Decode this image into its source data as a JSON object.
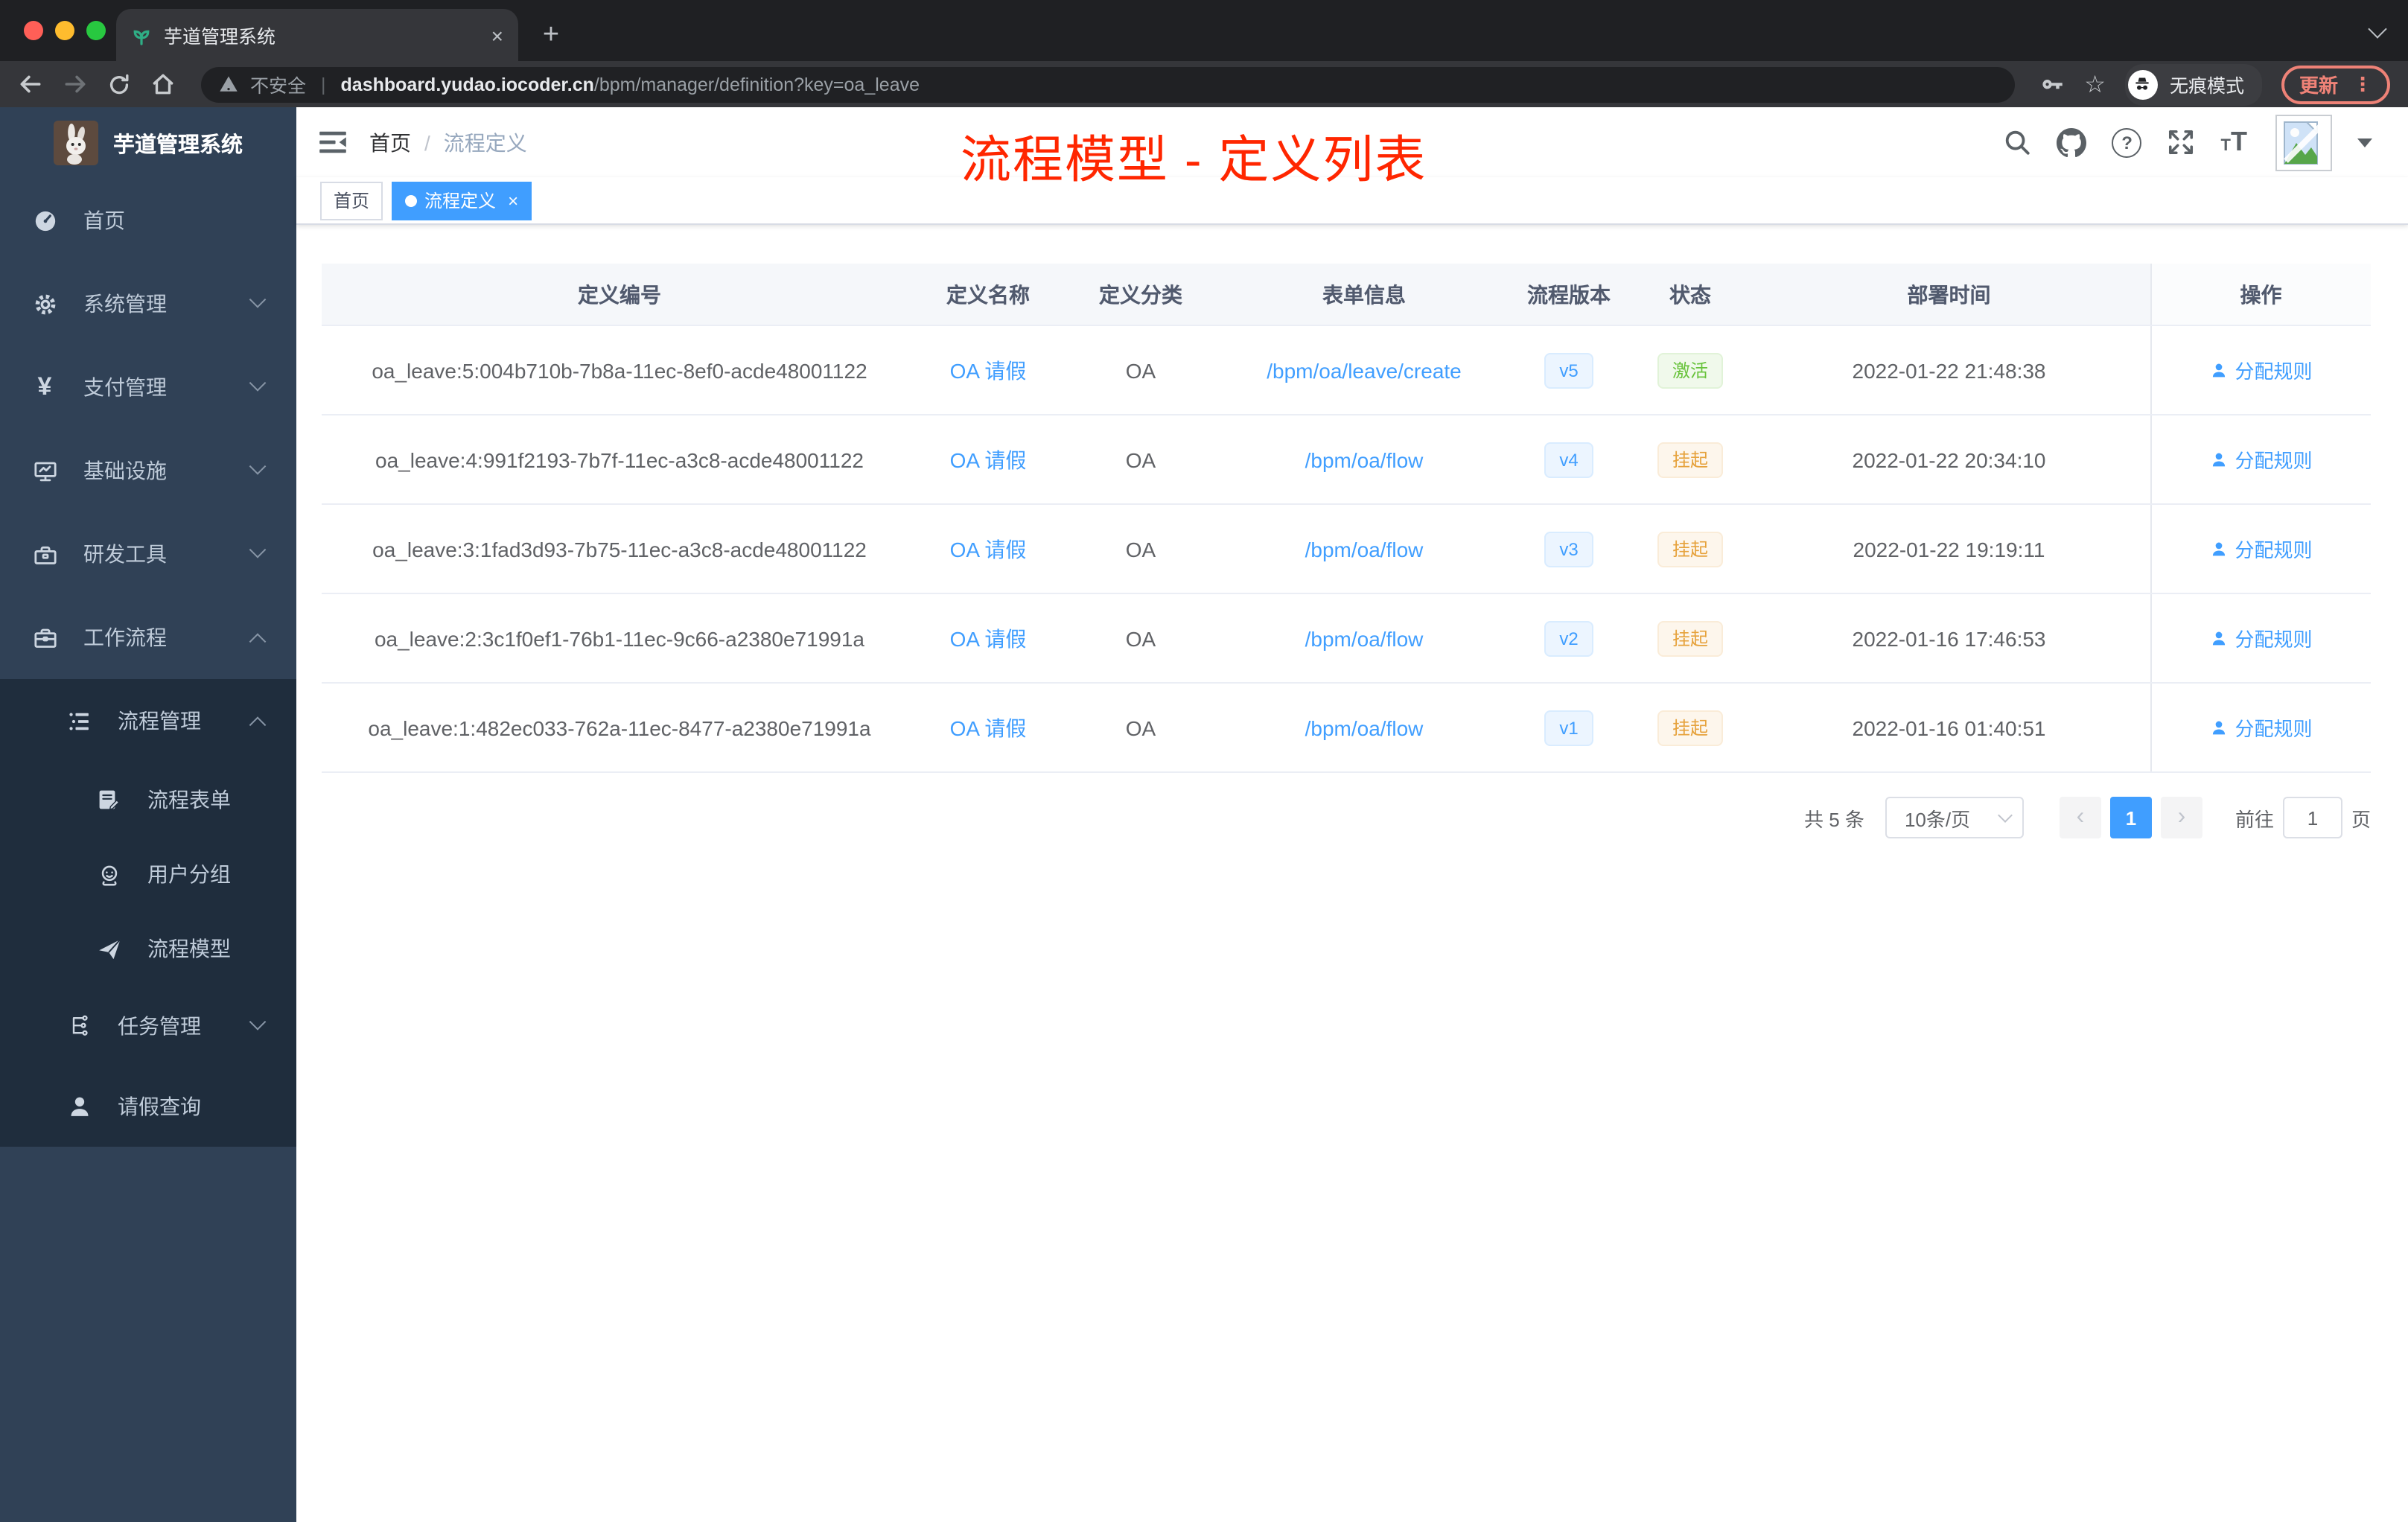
{
  "colors": {
    "accent_blue": "#409eff",
    "annotation_red": "#ff2600",
    "sidebar_bg": "#304156",
    "submenu_bg": "#1f2d3d",
    "success_green": "#67c23a",
    "warning_orange": "#e6a23c",
    "traffic_red": "#ff5f57",
    "traffic_yellow": "#febc2e",
    "traffic_green": "#28c840"
  },
  "icons": {
    "close": "×",
    "plus": "+",
    "prev": "‹",
    "next": "›",
    "question": "?",
    "yen": "¥",
    "letter_t": "T",
    "dot_menu": "⋮",
    "pipe": "|",
    "star": "☆",
    "slash": "/"
  },
  "browser": {
    "tab": {
      "title": "芋道管理系统"
    },
    "address": {
      "security": "不安全",
      "domain": "dashboard.yudao.iocoder.cn",
      "path": "/bpm/manager/definition?key=oa_leave"
    },
    "incognito_label": "无痕模式",
    "update_label": "更新"
  },
  "sidebar": {
    "logo_title": "芋道管理系统",
    "menu": [
      {
        "label": "首页",
        "icon": "dashboard-icon"
      },
      {
        "label": "系统管理",
        "icon": "gear-icon"
      },
      {
        "label": "支付管理",
        "icon": "yen-icon"
      },
      {
        "label": "基础设施",
        "icon": "monitor-icon"
      },
      {
        "label": "研发工具",
        "icon": "toolbox-icon"
      },
      {
        "label": "工作流程",
        "icon": "briefcase-icon"
      }
    ],
    "submenu": {
      "parent": {
        "label": "流程管理",
        "icon": "list-icon"
      },
      "children": [
        {
          "label": "流程表单",
          "icon": "form-icon"
        },
        {
          "label": "用户分组",
          "icon": "user-group-icon"
        },
        {
          "label": "流程模型",
          "icon": "paper-plane-icon"
        }
      ],
      "siblings": [
        {
          "label": "任务管理",
          "icon": "task-flow-icon"
        },
        {
          "label": "请假查询",
          "icon": "person-icon"
        }
      ]
    }
  },
  "header": {
    "breadcrumb": {
      "home": "首页",
      "current": "流程定义"
    },
    "annotation": "流程模型 - 定义列表"
  },
  "tags": [
    {
      "label": "首页",
      "active": false
    },
    {
      "label": "流程定义",
      "active": true
    }
  ],
  "table": {
    "columns": [
      "定义编号",
      "定义名称",
      "定义分类",
      "表单信息",
      "流程版本",
      "状态",
      "部署时间",
      "操作"
    ],
    "rows": [
      {
        "id": "oa_leave:5:004b710b-7b8a-11ec-8ef0-acde48001122",
        "name": "OA 请假",
        "category": "OA",
        "form": "/bpm/oa/leave/create",
        "version": "v5",
        "status": "激活",
        "status_type": "success",
        "time": "2022-01-22 21:48:38",
        "action": "分配规则"
      },
      {
        "id": "oa_leave:4:991f2193-7b7f-11ec-a3c8-acde48001122",
        "name": "OA 请假",
        "category": "OA",
        "form": "/bpm/oa/flow",
        "version": "v4",
        "status": "挂起",
        "status_type": "warning",
        "time": "2022-01-22 20:34:10",
        "action": "分配规则"
      },
      {
        "id": "oa_leave:3:1fad3d93-7b75-11ec-a3c8-acde48001122",
        "name": "OA 请假",
        "category": "OA",
        "form": "/bpm/oa/flow",
        "version": "v3",
        "status": "挂起",
        "status_type": "warning",
        "time": "2022-01-22 19:19:11",
        "action": "分配规则"
      },
      {
        "id": "oa_leave:2:3c1f0ef1-76b1-11ec-9c66-a2380e71991a",
        "name": "OA 请假",
        "category": "OA",
        "form": "/bpm/oa/flow",
        "version": "v2",
        "status": "挂起",
        "status_type": "warning",
        "time": "2022-01-16 17:46:53",
        "action": "分配规则"
      },
      {
        "id": "oa_leave:1:482ec033-762a-11ec-8477-a2380e71991a",
        "name": "OA 请假",
        "category": "OA",
        "form": "/bpm/oa/flow",
        "version": "v1",
        "status": "挂起",
        "status_type": "warning",
        "time": "2022-01-16 01:40:51",
        "action": "分配规则"
      }
    ]
  },
  "pagination": {
    "total": "共 5 条",
    "page_size": "10条/页",
    "current_page": "1",
    "goto_label": "前往",
    "page_label": "页"
  }
}
